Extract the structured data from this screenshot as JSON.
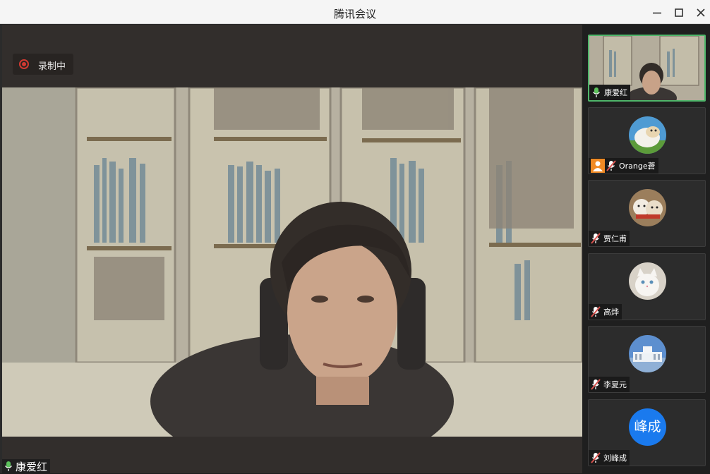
{
  "window": {
    "title": "腾讯会议"
  },
  "recording": {
    "label": "录制中"
  },
  "main_speaker": {
    "name": "康爱红",
    "mic": "on"
  },
  "participants": [
    {
      "name": "康爱红",
      "mic": "on",
      "avatar": "video-thumbnail",
      "active": true
    },
    {
      "name": "Orange蒼",
      "mic": "muted",
      "avatar": "sheep-photo",
      "host_badge": "person-icon"
    },
    {
      "name": "贾仁甫",
      "mic": "muted",
      "avatar": "dogs-photo"
    },
    {
      "name": "高烨",
      "mic": "muted",
      "avatar": "cat-photo"
    },
    {
      "name": "李夏元",
      "mic": "muted",
      "avatar": "building-photo"
    },
    {
      "name": "刘峰成",
      "mic": "muted",
      "avatar_text": "峰成",
      "avatar_color": "#1a7aee"
    }
  ],
  "colors": {
    "active_border": "#4fb66a",
    "mic_on": "#5cc15c",
    "mic_muted": "#d9534f",
    "record": "#d13a32"
  }
}
